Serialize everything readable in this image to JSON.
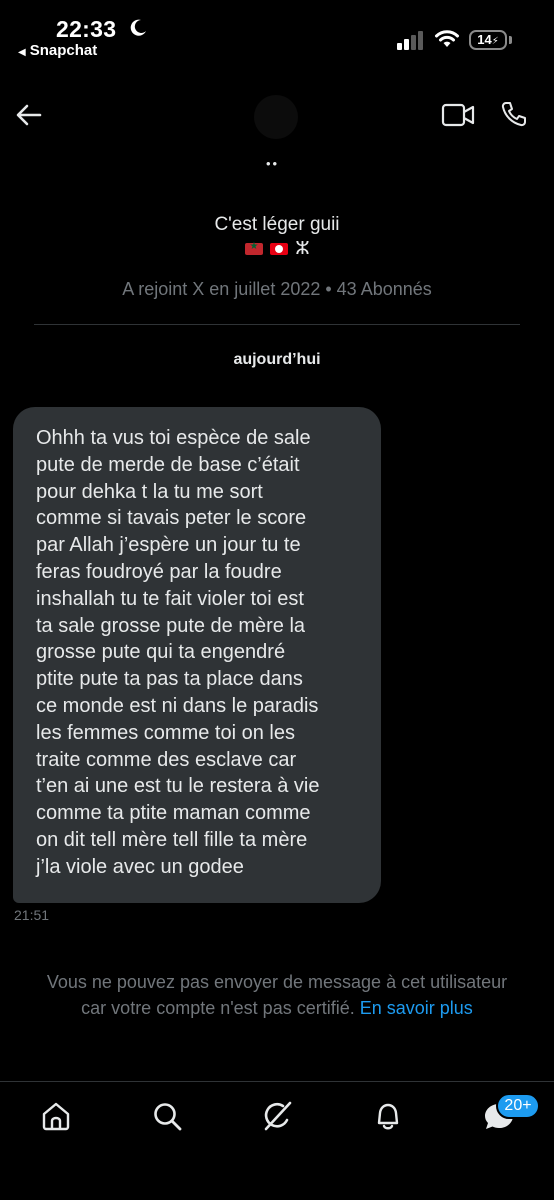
{
  "status_bar": {
    "time": "22:33",
    "back_app": "Snapchat",
    "battery": "14"
  },
  "header": {
    "dots": "••"
  },
  "profile": {
    "name": "C'est léger guii",
    "amazigh_symbol": "ⵣ",
    "joined": "A rejoint X en juillet 2022 • 43 Abonnés"
  },
  "conversation": {
    "date_label": "aujourd’hui",
    "message": {
      "text": "Ohhh ta vus toi espèce de sale\npute de merde de base c’était\npour dehka t la tu me sort\ncomme si tavais peter le score\npar Allah j’espère un jour tu te\nferas foudroyé par la foudre\ninshallah tu te fait violer toi est\nta sale grosse pute de mère la\ngrosse pute qui ta engendré\nptite pute ta pas ta place dans\nce monde est ni dans le paradis\nles femmes comme toi on les\ntraite comme des esclave car\nt’en ai une est tu le restera à vie\ncomme ta ptite maman comme\non dit tell mère tell fille ta mère\nj’la viole avec un godee",
      "time": "21:51"
    }
  },
  "notice": {
    "line1": "Vous ne pouvez pas envoyer de message à cet utilisateur",
    "line2": "car votre compte n'est pas certifié.",
    "link": "En savoir plus"
  },
  "bottom_nav": {
    "items": [
      "home-icon",
      "search-icon",
      "grok-icon",
      "bell-icon",
      "messages-icon"
    ],
    "messages_badge": "20+"
  },
  "colors": {
    "background": "#000000",
    "bubble": "#2f3336",
    "muted": "#71767b",
    "accent": "#1d9bf0"
  }
}
